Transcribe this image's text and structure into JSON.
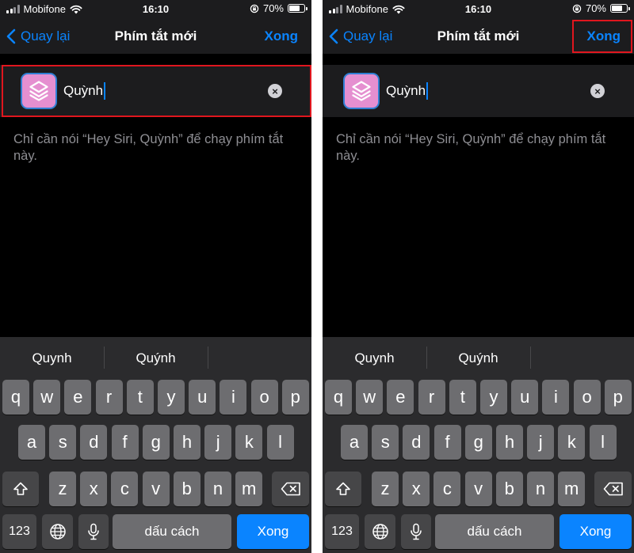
{
  "status": {
    "carrier": "Mobifone",
    "time": "16:10",
    "battery": "70%",
    "battery_level": 0.7
  },
  "nav": {
    "back_label": "Quay lại",
    "title": "Phím tắt mới",
    "done_label": "Xong"
  },
  "shortcut": {
    "name_value": "Quỳnh",
    "hint": "Chỉ cần nói “Hey Siri, Quỳnh” để chạy phím tắt này."
  },
  "keyboard": {
    "suggestions": [
      "Quynh",
      "Quýnh",
      ""
    ],
    "rows": [
      [
        "q",
        "w",
        "e",
        "r",
        "t",
        "y",
        "u",
        "i",
        "o",
        "p"
      ],
      [
        "a",
        "s",
        "d",
        "f",
        "g",
        "h",
        "j",
        "k",
        "l"
      ],
      [
        "z",
        "x",
        "c",
        "v",
        "b",
        "n",
        "m"
      ]
    ],
    "numbers_label": "123",
    "space_label": "dấu cách",
    "return_label": "Xong"
  },
  "colors": {
    "accent": "#0a84ff",
    "highlight": "#e0161e",
    "icon_bg": "#e58fd0"
  }
}
